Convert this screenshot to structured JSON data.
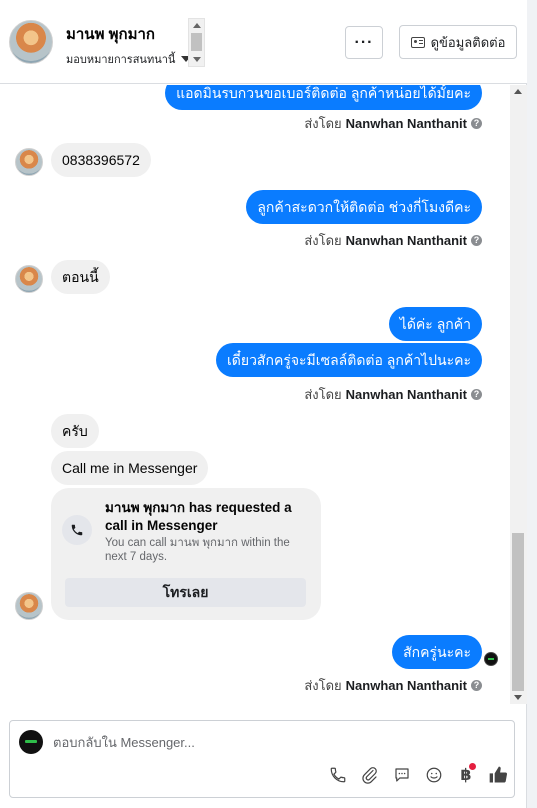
{
  "header": {
    "contact_name": "มานพ พุกมาก",
    "assign_label": "มอบหมายการสนทนานี้",
    "more_label": "···",
    "view_contact_label": "ดูข้อมูลติดต่อ"
  },
  "messages": [
    {
      "kind": "out",
      "text": "แอดมินรบกวนขอเบอร์ติดต่อ ลูกค้าหน่อยได้มั้ยคะ"
    },
    {
      "kind": "in",
      "text": "0838396572"
    },
    {
      "kind": "out",
      "text": "ลูกค้าสะดวกให้ติดต่อ ช่วงกี่โมงดีคะ"
    },
    {
      "kind": "in",
      "text": "ตอนนี้"
    },
    {
      "kind": "out",
      "text": "ได้ค่ะ ลูกค้า"
    },
    {
      "kind": "out",
      "text": "เดี๋ยวสักครู่จะมีเซลล์ติดต่อ ลูกค้าไปนะคะ"
    },
    {
      "kind": "in",
      "text": "ครับ"
    },
    {
      "kind": "in",
      "text": "Call me in Messenger"
    },
    {
      "kind": "out",
      "text": "สักครู่นะคะ"
    }
  ],
  "sent_by": {
    "prefix": "ส่งโดย",
    "agent": "Nanwhan Nanthanit",
    "help": "?"
  },
  "call_request": {
    "title": "มานพ พุกมาก has requested a call in Messenger",
    "subtitle": "You can call มานพ พุกมาก within the next 7 days.",
    "button": "โทรเลย"
  },
  "composer": {
    "placeholder": "ตอบกลับใน Messenger..."
  },
  "icons": [
    "phone-icon",
    "paperclip-icon",
    "saved-reply-icon",
    "emoji-icon",
    "baht-icon",
    "like-icon"
  ],
  "colors": {
    "outgoing": "#0a7cff",
    "incoming": "#f0f0f0",
    "badge": "#e41e3f"
  }
}
